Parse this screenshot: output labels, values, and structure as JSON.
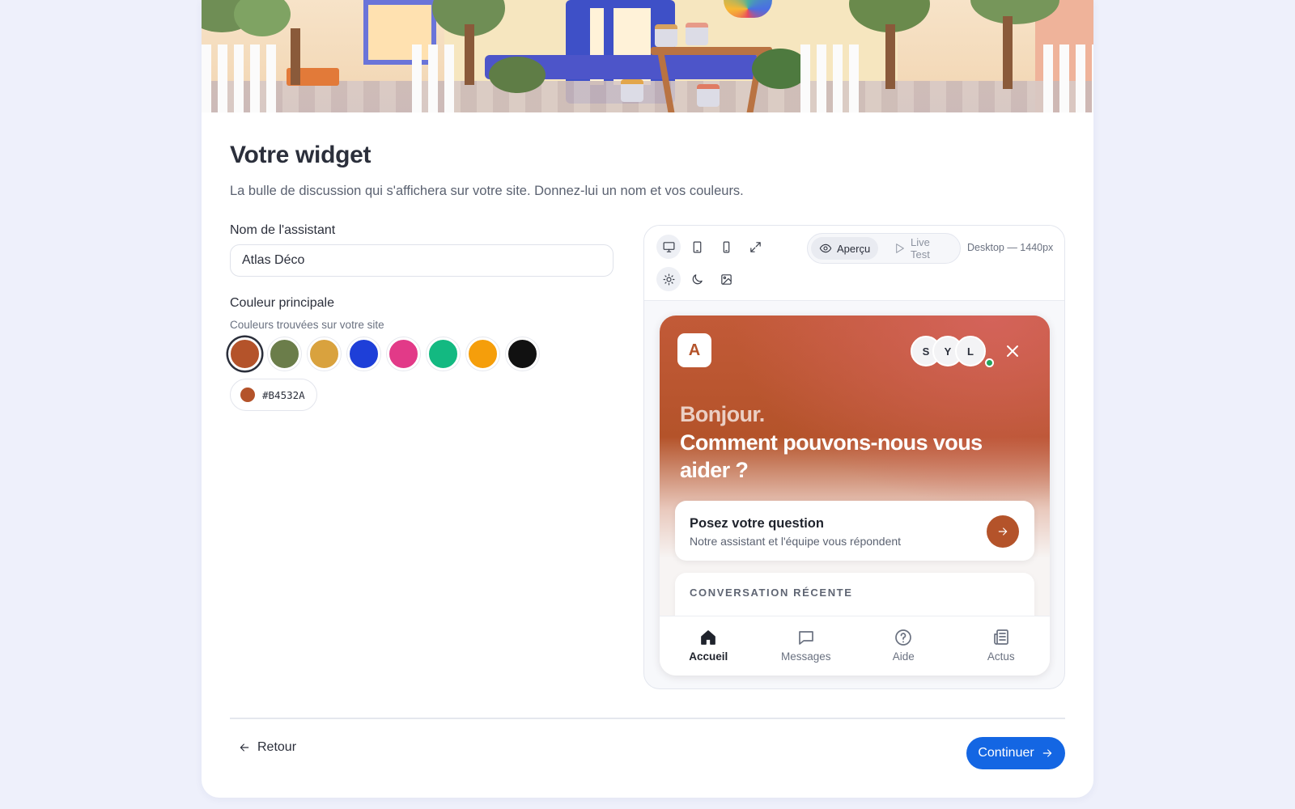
{
  "page": {
    "title": "Votre widget",
    "subtitle": "La bulle de discussion qui s'affichera sur votre site. Donnez-lui un nom et vos couleurs."
  },
  "form": {
    "name_label": "Nom de l'assistant",
    "name_value": "Atlas Déco",
    "color_label": "Couleur principale",
    "color_hint": "Couleurs trouvées sur votre site",
    "swatches": [
      "#B4532A",
      "#6B7D4A",
      "#D9A23E",
      "#1E3FD8",
      "#E23A88",
      "#13B981",
      "#F59E0B",
      "#111111"
    ],
    "selected_color": "#B4532A"
  },
  "preview": {
    "devices": [
      "desktop-icon",
      "tablet-icon",
      "mobile-icon",
      "expand-icon"
    ],
    "themes": [
      "sun-icon",
      "moon-icon",
      "image-icon"
    ],
    "mode_preview": "Aperçu",
    "mode_live": "Live Test",
    "size_label": "Desktop — 1440px",
    "widget": {
      "avatar_letter": "A",
      "team": [
        "S",
        "Y",
        "L"
      ],
      "greeting_line1": "Bonjour.",
      "greeting_line2": "Comment pouvons-nous vous aider ?",
      "ask_title": "Posez votre question",
      "ask_subtitle": "Notre assistant et l'équipe vous répondent",
      "recent_title": "CONVERSATION RÉCENTE",
      "nav": [
        {
          "label": "Accueil",
          "icon": "home-icon"
        },
        {
          "label": "Messages",
          "icon": "chat-icon"
        },
        {
          "label": "Aide",
          "icon": "help-icon"
        },
        {
          "label": "Actus",
          "icon": "news-icon"
        }
      ]
    }
  },
  "footer": {
    "back_label": "Retour",
    "continue_label": "Continuer"
  }
}
